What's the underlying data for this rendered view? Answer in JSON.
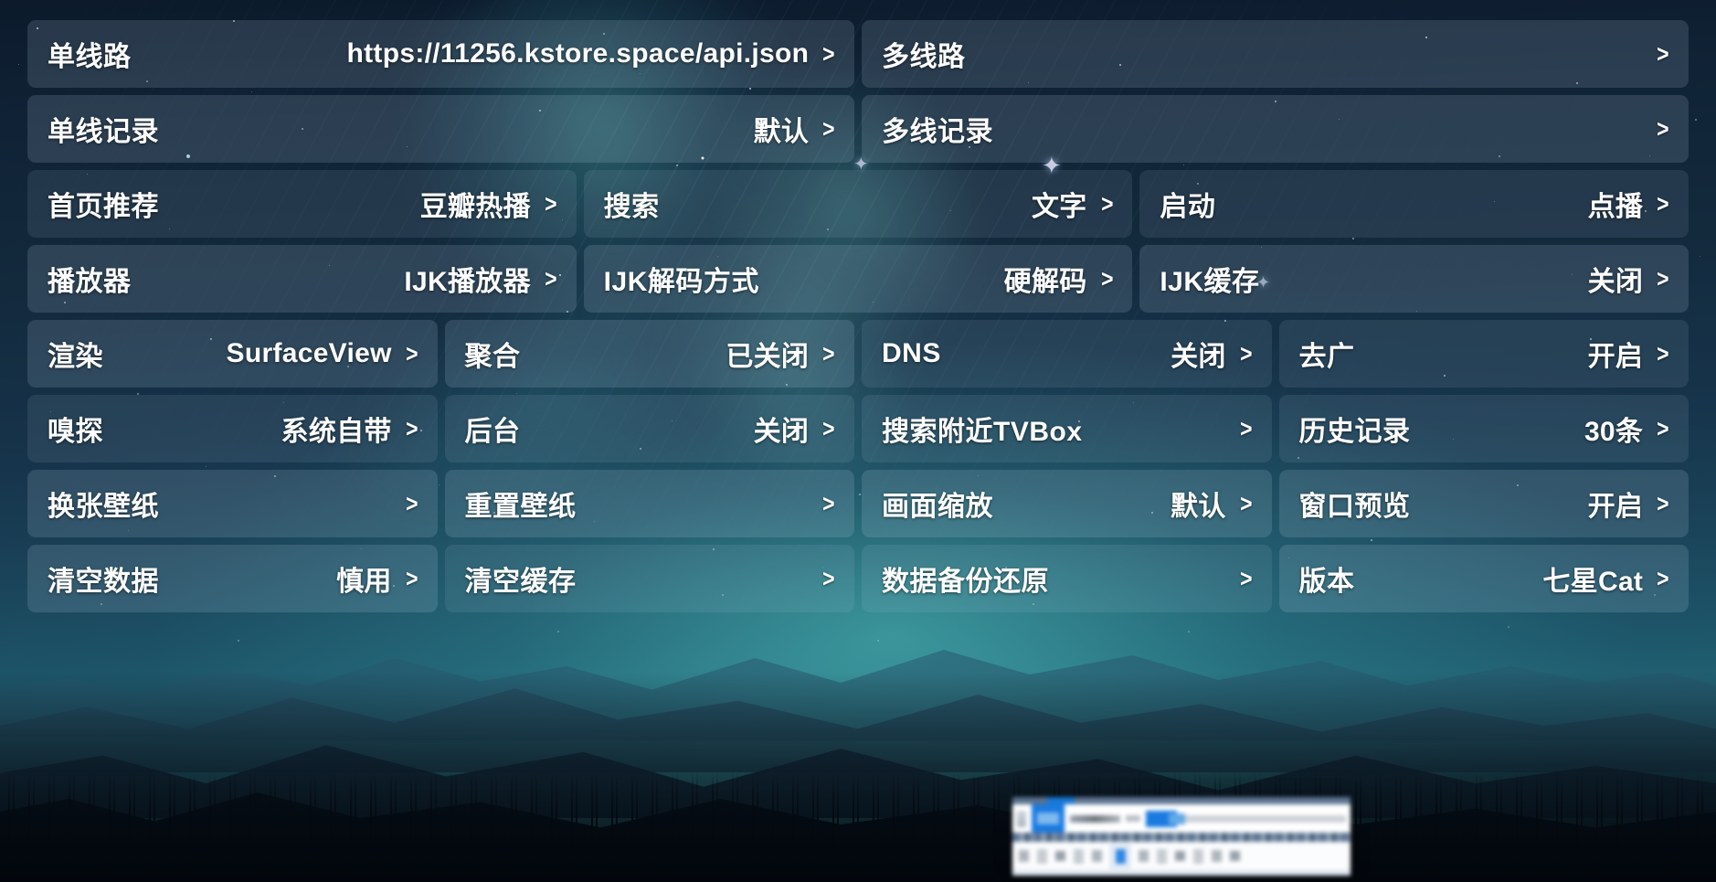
{
  "screen": {
    "app": "TVBox settings",
    "accent_color": "#ffffff",
    "card_background": "rgba(195,215,235,0.10)"
  },
  "chevron": ">",
  "rows": [
    {
      "id": "row-1",
      "cells": [
        {
          "name": "single-line-source",
          "label": "单线路",
          "value": "https://11256.kstore.space/api.json",
          "chevron": ">",
          "focused": true,
          "width": "half"
        },
        {
          "name": "multi-line-source",
          "label": "多线路",
          "value": "",
          "chevron": ">",
          "focused": true,
          "width": "half"
        }
      ]
    },
    {
      "id": "row-2",
      "cells": [
        {
          "name": "single-line-history",
          "label": "单线记录",
          "value": "默认",
          "chevron": ">",
          "focused": true,
          "width": "half"
        },
        {
          "name": "multi-line-history",
          "label": "多线记录",
          "value": "",
          "chevron": ">",
          "focused": true,
          "width": "half"
        }
      ]
    },
    {
      "id": "row-3",
      "cells": [
        {
          "name": "home-recommend",
          "label": "首页推荐",
          "value": "豆瓣热播",
          "chevron": ">",
          "focused": false,
          "width": "third"
        },
        {
          "name": "search-mode",
          "label": "搜索",
          "value": "文字",
          "chevron": ">",
          "focused": false,
          "width": "third"
        },
        {
          "name": "startup-mode",
          "label": "启动",
          "value": "点播",
          "chevron": ">",
          "focused": false,
          "width": "third"
        }
      ]
    },
    {
      "id": "row-4",
      "cells": [
        {
          "name": "player",
          "label": "播放器",
          "value": "IJK播放器",
          "chevron": ">",
          "focused": true,
          "width": "third"
        },
        {
          "name": "ijk-decode-mode",
          "label": "IJK解码方式",
          "value": "硬解码",
          "chevron": ">",
          "focused": true,
          "width": "third"
        },
        {
          "name": "ijk-cache",
          "label": "IJK缓存",
          "value": "关闭",
          "chevron": ">",
          "focused": true,
          "width": "third"
        }
      ]
    },
    {
      "id": "row-5",
      "cells": [
        {
          "name": "render",
          "label": "渲染",
          "value": "SurfaceView",
          "chevron": ">",
          "focused": true,
          "width": "quarter"
        },
        {
          "name": "aggregate-search",
          "label": "聚合",
          "value": "已关闭",
          "chevron": ">",
          "focused": true,
          "width": "quarter"
        },
        {
          "name": "dns",
          "label": "DNS",
          "value": "关闭",
          "chevron": ">",
          "focused": false,
          "width": "quarter"
        },
        {
          "name": "ad-block",
          "label": "去广",
          "value": "开启",
          "chevron": ">",
          "focused": false,
          "width": "quarter"
        }
      ]
    },
    {
      "id": "row-6",
      "cells": [
        {
          "name": "sniffer",
          "label": "嗅探",
          "value": "系统自带",
          "chevron": ">",
          "focused": false,
          "width": "quarter"
        },
        {
          "name": "background-play",
          "label": "后台",
          "value": "关闭",
          "chevron": ">",
          "focused": false,
          "width": "quarter"
        },
        {
          "name": "search-nearby-tvbox",
          "label": "搜索附近TVBox",
          "value": "",
          "chevron": ">",
          "focused": false,
          "width": "quarter"
        },
        {
          "name": "history-records",
          "label": "历史记录",
          "value": "30条",
          "chevron": ">",
          "focused": false,
          "width": "quarter"
        }
      ]
    },
    {
      "id": "row-7",
      "cells": [
        {
          "name": "change-wallpaper",
          "label": "换张壁纸",
          "value": "",
          "chevron": ">",
          "focused": true,
          "width": "quarter"
        },
        {
          "name": "reset-wallpaper",
          "label": "重置壁纸",
          "value": "",
          "chevron": ">",
          "focused": true,
          "width": "quarter"
        },
        {
          "name": "screen-scale",
          "label": "画面缩放",
          "value": "默认",
          "chevron": ">",
          "focused": true,
          "width": "quarter"
        },
        {
          "name": "window-preview",
          "label": "窗口预览",
          "value": "开启",
          "chevron": ">",
          "focused": true,
          "width": "quarter"
        }
      ]
    },
    {
      "id": "row-8",
      "cells": [
        {
          "name": "clear-data",
          "label": "清空数据",
          "value": "慎用",
          "chevron": ">",
          "focused": true,
          "width": "quarter"
        },
        {
          "name": "clear-cache",
          "label": "清空缓存",
          "value": "",
          "chevron": ">",
          "focused": false,
          "width": "quarter"
        },
        {
          "name": "backup-restore",
          "label": "数据备份还原",
          "value": "",
          "chevron": ">",
          "focused": false,
          "width": "quarter"
        },
        {
          "name": "version",
          "label": "版本",
          "value": "七星Cat",
          "chevron": ">",
          "focused": true,
          "width": "quarter"
        }
      ]
    }
  ],
  "overlay_widget": {
    "name": "blurred-floating-toolbar",
    "description": "blurred minimized window / input toolbar at bottom right"
  }
}
